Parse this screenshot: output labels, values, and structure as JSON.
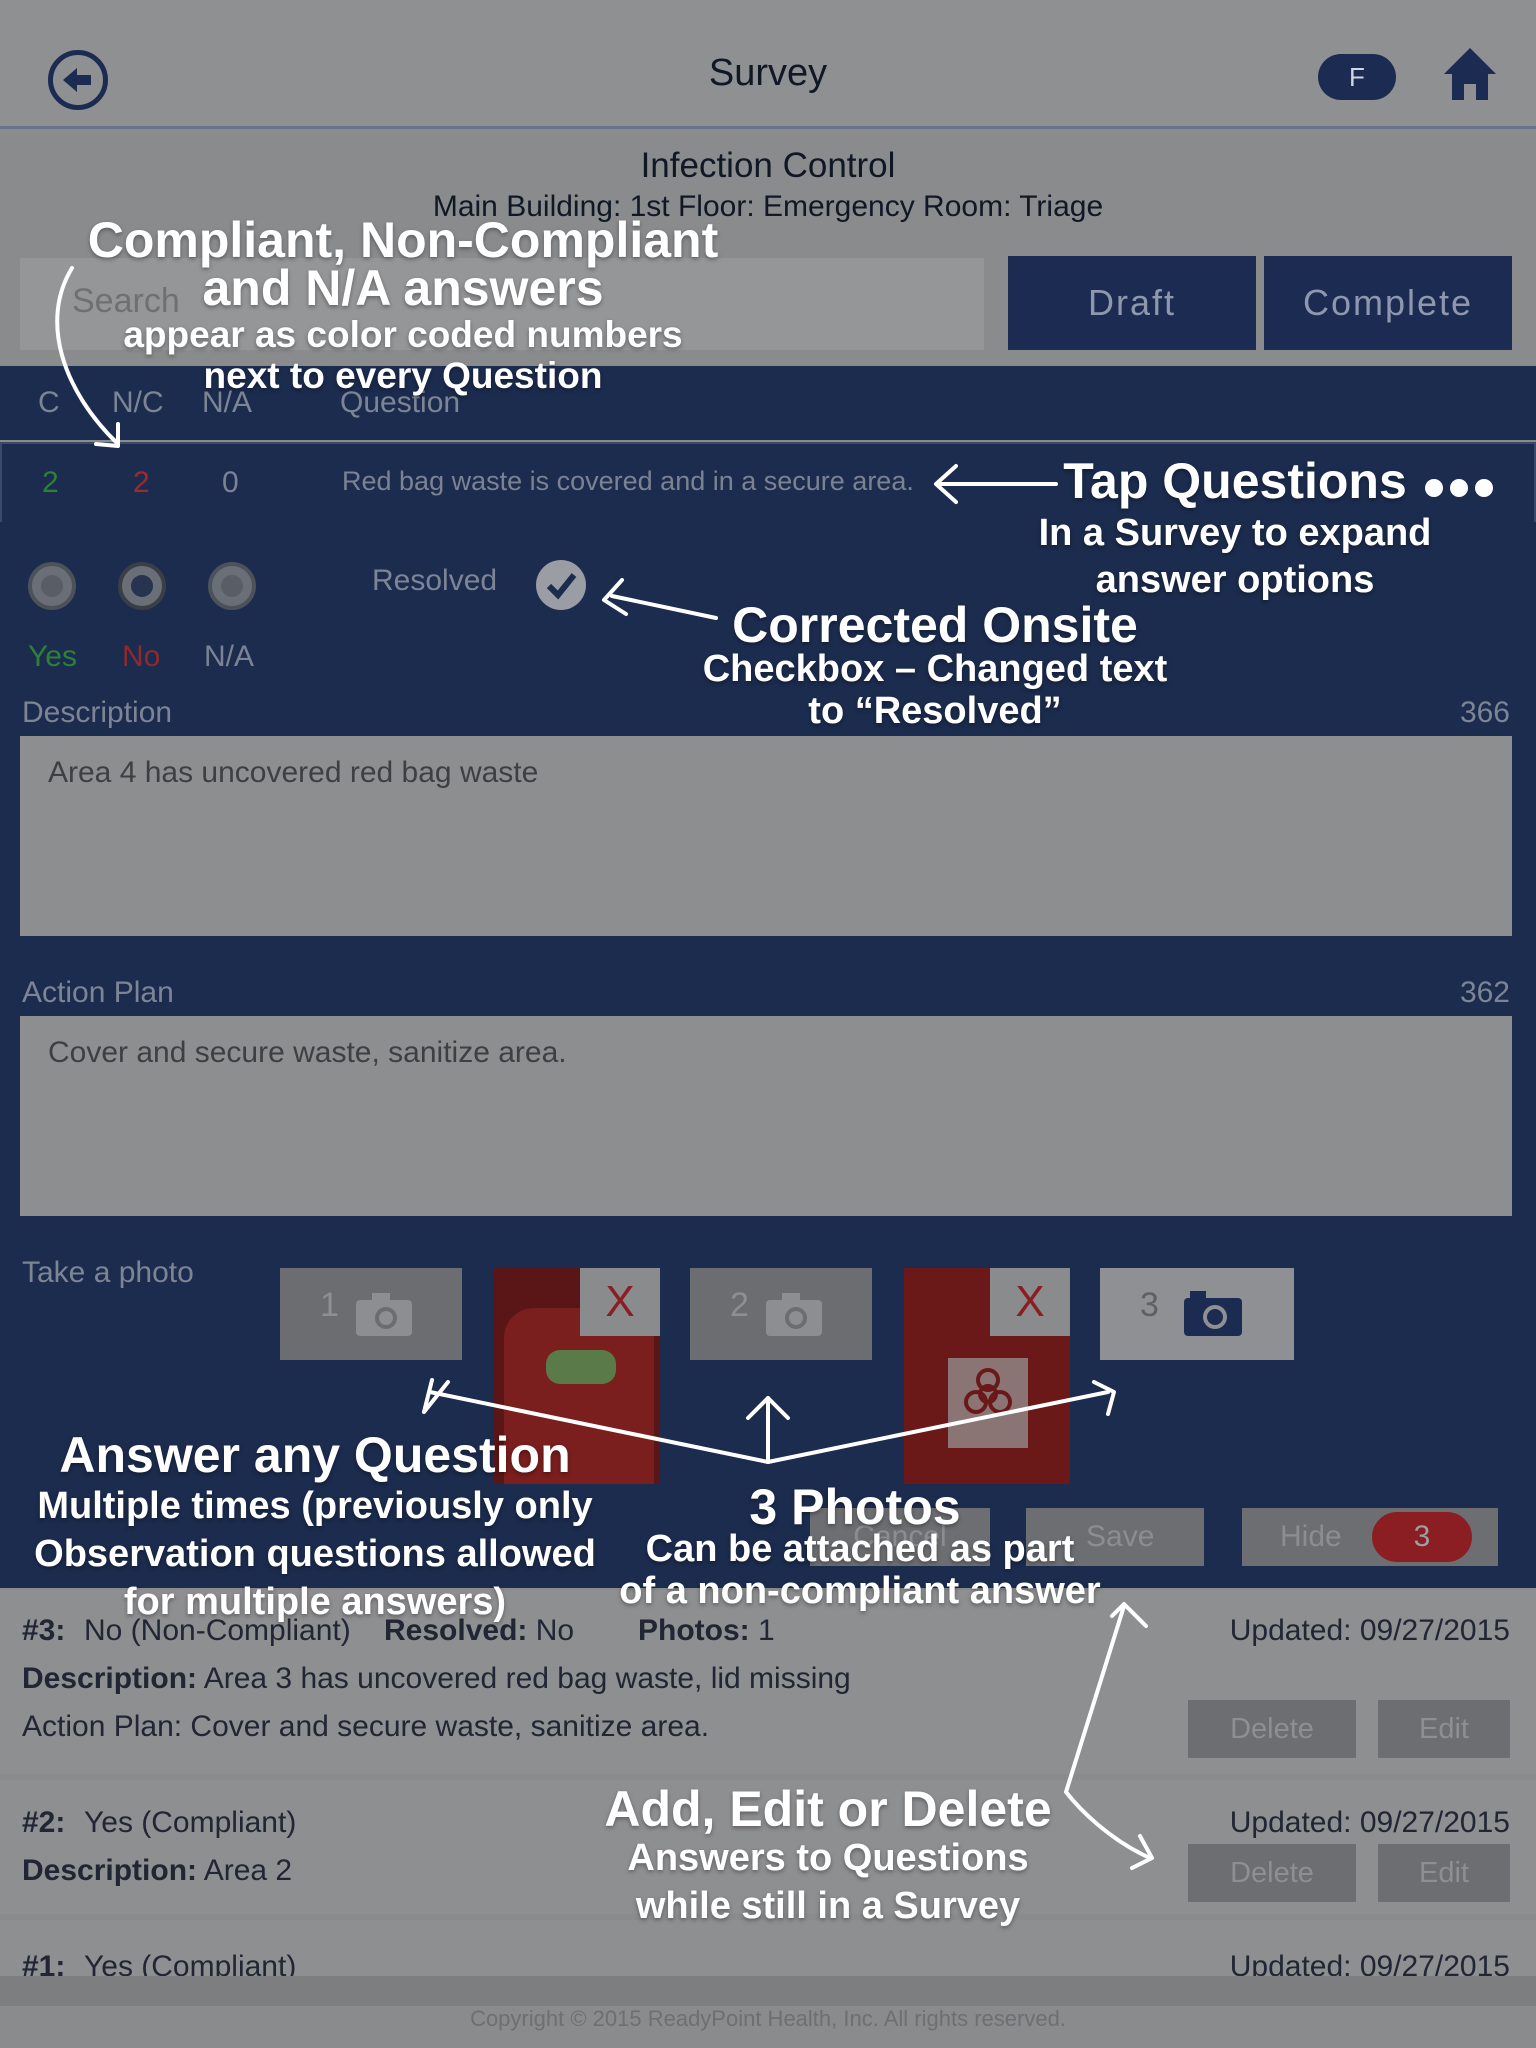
{
  "header": {
    "title": "Survey",
    "user_initial": "F"
  },
  "survey": {
    "section": "Infection Control",
    "location": "Main Building: 1st Floor: Emergency Room: Triage"
  },
  "search": {
    "placeholder": "Search"
  },
  "actions": {
    "draft": "Draft",
    "complete": "Complete"
  },
  "columns": {
    "c": "C",
    "nc": "N/C",
    "na": "N/A",
    "question": "Question"
  },
  "question": {
    "c_count": "2",
    "nc_count": "2",
    "na_count": "0",
    "text": "Red bag waste is covered and in a secure area."
  },
  "answer_options": {
    "yes": "Yes",
    "no": "No",
    "na": "N/A",
    "resolved": "Resolved",
    "selected": "No"
  },
  "description": {
    "label": "Description",
    "counter": "366",
    "value": "Area 4 has uncovered red bag waste"
  },
  "action_plan": {
    "label": "Action Plan",
    "counter": "362",
    "value": "Cover and secure waste, sanitize area."
  },
  "photos": {
    "label": "Take a photo",
    "slot1": "1",
    "slot2": "2",
    "slot3": "3",
    "remove": "X"
  },
  "buttons": {
    "cancel": "Cancel",
    "save": "Save",
    "hide": "Hide",
    "hide_count": "3"
  },
  "answers": [
    {
      "num": "#3:",
      "status": "No (Non-Compliant)",
      "resolved_label": "Resolved:",
      "resolved": "No",
      "photos_label": "Photos:",
      "photos": "1",
      "updated": "Updated: 09/27/2015",
      "desc_label": "Description:",
      "desc": "Area 3 has uncovered red bag waste, lid missing",
      "plan": "Action Plan: Cover and secure waste, sanitize area.",
      "delete": "Delete",
      "edit": "Edit"
    },
    {
      "num": "#2:",
      "status": "Yes (Compliant)",
      "updated": "Updated: 09/27/2015",
      "desc_label": "Description:",
      "desc": "Area 2",
      "delete": "Delete",
      "edit": "Edit"
    },
    {
      "num": "#1:",
      "status": "Yes (Compliant)",
      "updated": "Updated: 09/27/2015"
    }
  ],
  "footer": "Copyright © 2015 ReadyPoint Health, Inc. All rights reserved.",
  "annotations": {
    "a1_title_1": "Compliant, Non-Compliant",
    "a1_title_2": "and N/A answers",
    "a1_sub_1": "appear as color coded numbers",
    "a1_sub_2": "next to every Question",
    "a2_title": "Tap Questions",
    "a2_sub_1": "In a Survey to expand",
    "a2_sub_2": "answer options",
    "a3_title": "Corrected Onsite",
    "a3_sub_1": "Checkbox – Changed text",
    "a3_sub_2": "to “Resolved”",
    "a4_title": "Answer any Question",
    "a4_sub_1": "Multiple times (previously only",
    "a4_sub_2": "Observation questions allowed",
    "a4_sub_3": "for multiple answers)",
    "a5_title": "3 Photos",
    "a5_sub_1": "Can be attached as part",
    "a5_sub_2": "of a non-compliant answer",
    "a6_title": "Add, Edit or Delete",
    "a6_sub_1": "Answers to Questions",
    "a6_sub_2": "while still in a Survey"
  },
  "colors": {
    "navy": "#1c2c4e",
    "compliant": "#2e8b3c",
    "noncompliant": "#b8262a",
    "overlay_gray": "#8a8b8d"
  }
}
